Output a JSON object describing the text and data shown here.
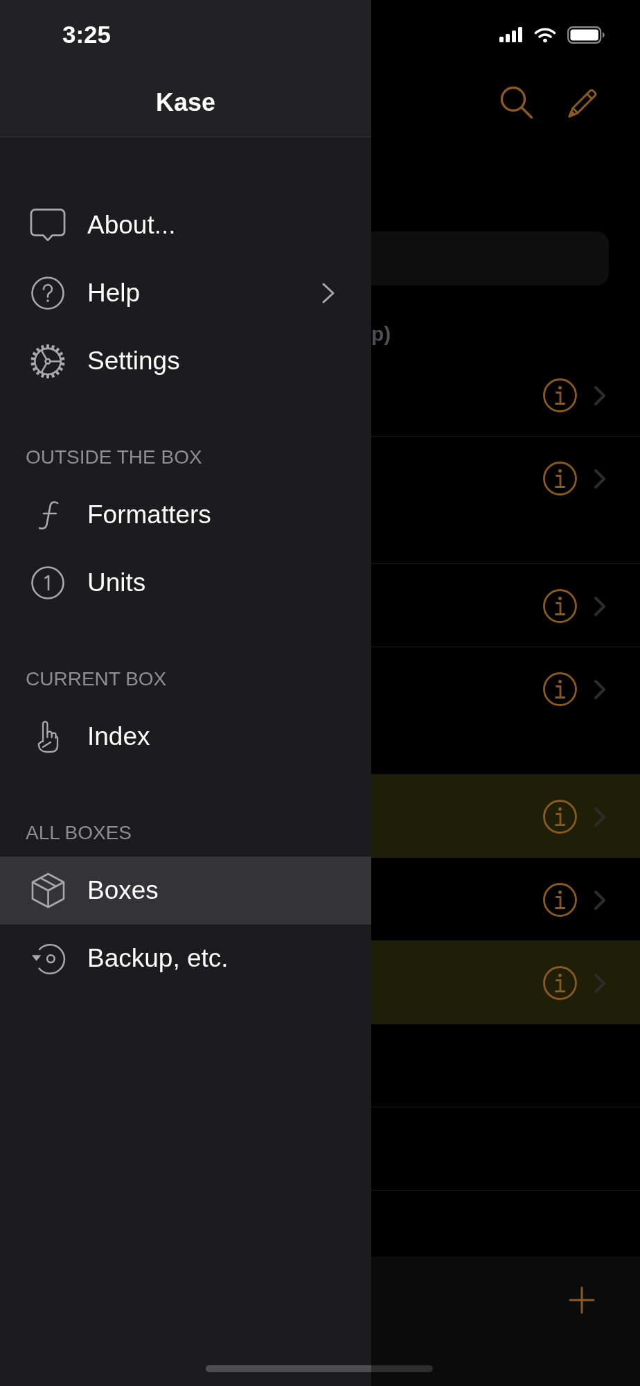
{
  "status_bar": {
    "time": "3:25"
  },
  "drawer": {
    "title": "Kase",
    "sections": [
      {
        "items": [
          {
            "label": "About...",
            "selected": false,
            "expandable": false
          },
          {
            "label": "Help",
            "selected": false,
            "expandable": true
          },
          {
            "label": "Settings",
            "selected": false,
            "expandable": false
          }
        ]
      },
      {
        "header": "OUTSIDE THE BOX",
        "items": [
          {
            "label": "Formatters",
            "selected": false,
            "expandable": false
          },
          {
            "label": "Units",
            "selected": false,
            "expandable": false
          }
        ]
      },
      {
        "header": "CURRENT BOX",
        "items": [
          {
            "label": "Index",
            "selected": false,
            "expandable": false
          }
        ]
      },
      {
        "header": "ALL BOXES",
        "items": [
          {
            "label": "Boxes",
            "selected": true,
            "expandable": false
          },
          {
            "label": "Backup, etc.",
            "selected": false,
            "expandable": false
          }
        ]
      }
    ]
  },
  "background": {
    "section_header": "p)",
    "rows": [
      {
        "kind": "single",
        "highlighted": false
      },
      {
        "kind": "double",
        "highlighted": false
      },
      {
        "kind": "single",
        "highlighted": false
      },
      {
        "kind": "double",
        "highlighted": false
      },
      {
        "kind": "single",
        "highlighted": true
      },
      {
        "kind": "single",
        "highlighted": false
      },
      {
        "kind": "single",
        "highlighted": true
      },
      {
        "kind": "empty",
        "highlighted": false
      },
      {
        "kind": "empty",
        "highlighted": false
      }
    ]
  }
}
